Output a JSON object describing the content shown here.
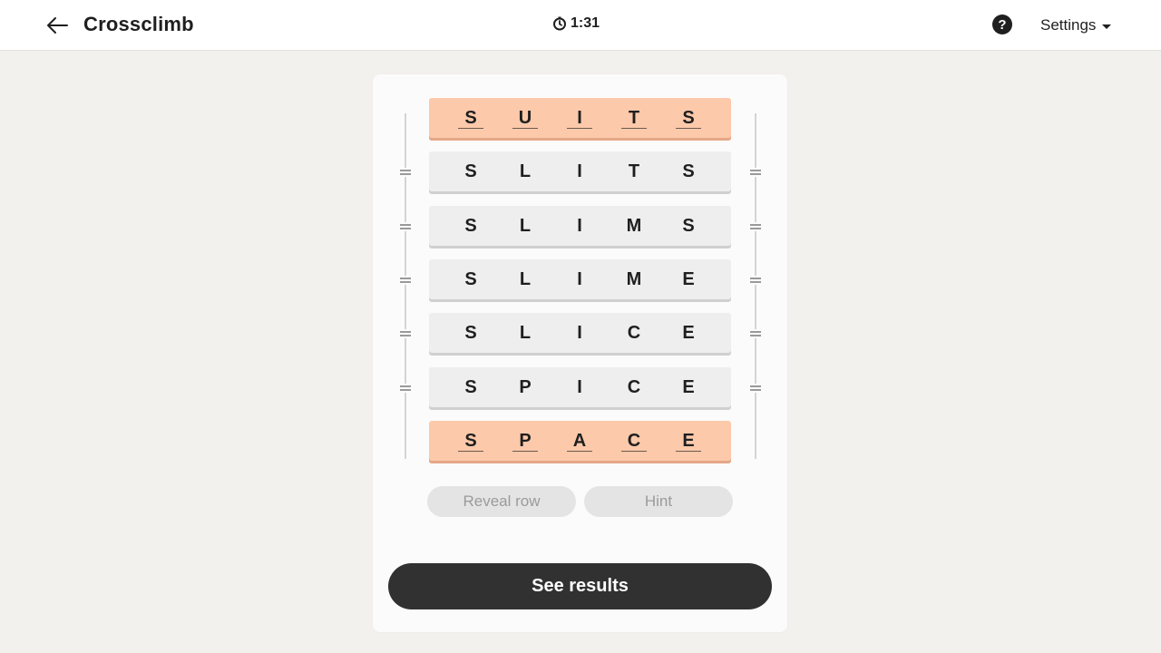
{
  "header": {
    "title": "Crossclimb",
    "timer": "1:31",
    "help_label": "?",
    "settings_label": "Settings"
  },
  "icons": {
    "back": "arrow-left-icon",
    "timer": "clock-icon",
    "help": "question-circle-icon",
    "settings": "chevron-down-icon"
  },
  "puzzle": {
    "rows": [
      {
        "letters": [
          "S",
          "U",
          "I",
          "T",
          "S"
        ],
        "state": "fixed"
      },
      {
        "letters": [
          "S",
          "L",
          "I",
          "T",
          "S"
        ],
        "state": "movable"
      },
      {
        "letters": [
          "S",
          "L",
          "I",
          "M",
          "S"
        ],
        "state": "movable"
      },
      {
        "letters": [
          "S",
          "L",
          "I",
          "M",
          "E"
        ],
        "state": "movable"
      },
      {
        "letters": [
          "S",
          "L",
          "I",
          "C",
          "E"
        ],
        "state": "movable"
      },
      {
        "letters": [
          "S",
          "P",
          "I",
          "C",
          "E"
        ],
        "state": "movable"
      },
      {
        "letters": [
          "S",
          "P",
          "A",
          "C",
          "E"
        ],
        "state": "fixed"
      }
    ]
  },
  "actions": {
    "reveal_row": "Reveal row",
    "hint": "Hint",
    "see_results": "See results"
  },
  "colors": {
    "fixed_row": "#fcc9aa",
    "movable_row": "#eeeeee",
    "primary_button": "#313131",
    "background": "#f3f1ed"
  }
}
